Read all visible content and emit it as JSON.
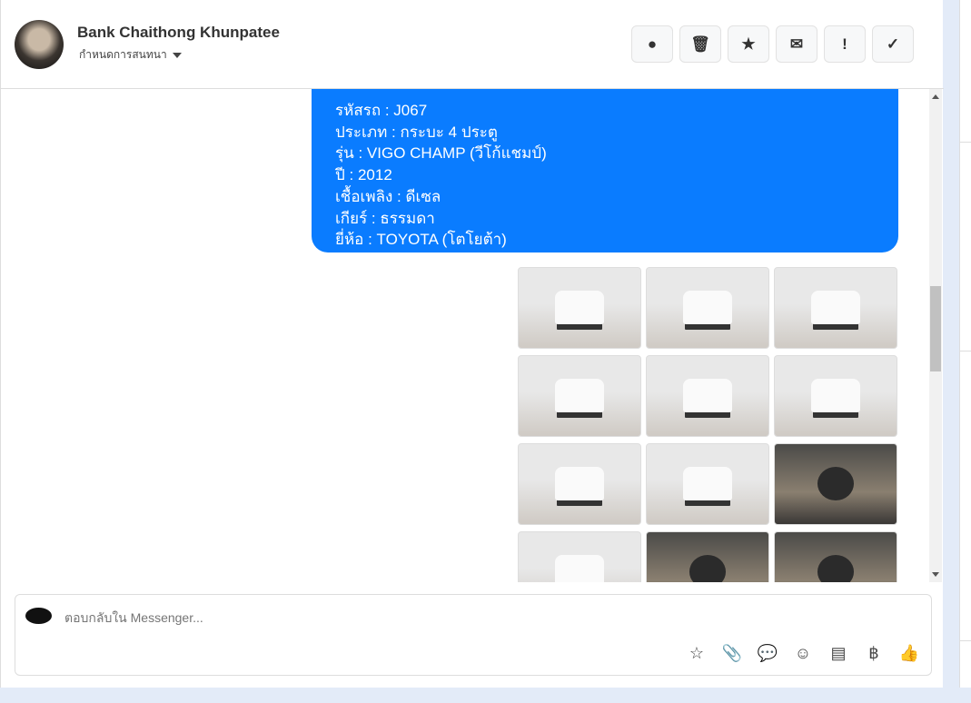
{
  "header": {
    "name": "Bank Chaithong Khunpatee",
    "subtitle": "กำหนดการสนทนา",
    "actions": [
      {
        "icon": "alert-circle-icon",
        "glyph": "●"
      },
      {
        "icon": "trash-icon",
        "glyph": "🗑"
      },
      {
        "icon": "star-icon",
        "glyph": "★"
      },
      {
        "icon": "envelope-icon",
        "glyph": "✉"
      },
      {
        "icon": "exclamation-icon",
        "glyph": "!"
      },
      {
        "icon": "check-icon",
        "glyph": "✓"
      }
    ]
  },
  "message": {
    "lines": [
      "รหัสรถ : J067",
      "ประเภท : กระบะ 4 ประตู",
      "รุ่น : VIGO CHAMP (วีโก้แชมป์)",
      "ปี : 2012",
      "เชื้อเพลิง : ดีเซล",
      "เกียร์ : ธรรมดา",
      "ยี่ห้อ : TOYOTA (โตโยต้า)"
    ]
  },
  "composer": {
    "placeholder": "ตอบกลับใน Messenger...",
    "tools": [
      {
        "icon": "saved-reply-icon",
        "glyph": "☆"
      },
      {
        "icon": "attachment-icon",
        "glyph": "📎"
      },
      {
        "icon": "chat-bubble-icon",
        "glyph": "💬"
      },
      {
        "icon": "emoji-icon",
        "glyph": "☺"
      },
      {
        "icon": "notes-icon",
        "glyph": "▤"
      },
      {
        "icon": "baht-icon",
        "glyph": "฿"
      },
      {
        "icon": "thumbs-up-icon",
        "glyph": "👍"
      }
    ]
  }
}
